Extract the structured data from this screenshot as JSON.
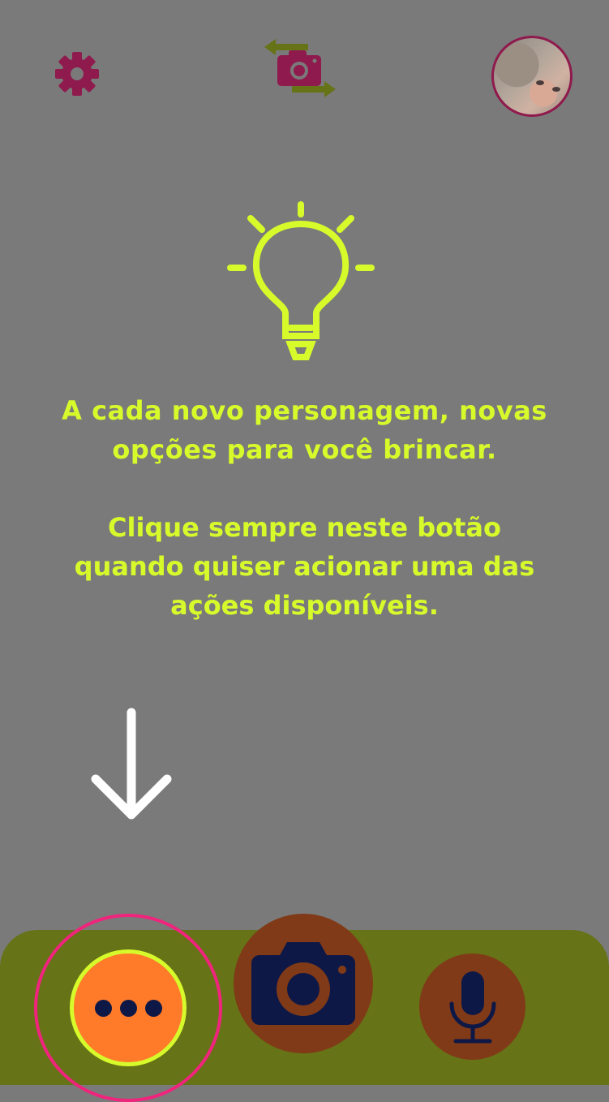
{
  "header": {
    "settings_icon": "gear-icon",
    "switch_camera_icon": "switch-camera-icon",
    "avatar": "profile-photo"
  },
  "tutorial": {
    "icon": "lightbulb-icon",
    "message_line1": "A cada novo personagem, novas",
    "message_line2": "opções para você brincar.",
    "instruction_line1": "Clique sempre neste botão",
    "instruction_line2": "quando quiser acionar uma das",
    "instruction_line3": "ações disponíveis.",
    "pointer_icon": "arrow-down-icon"
  },
  "bottom_bar": {
    "more_icon": "more-dots-icon",
    "camera_icon": "camera-icon",
    "mic_icon": "microphone-icon"
  },
  "colors": {
    "overlay": "#7a7a7a",
    "accent_lime": "#d7fa2b",
    "brand_magenta": "#8f1a4d",
    "bar_olive": "#667317",
    "button_orange": "#ff7a29",
    "button_brown": "#813a17",
    "icon_navy": "#0e1846",
    "highlight_pink": "#f0247c"
  }
}
